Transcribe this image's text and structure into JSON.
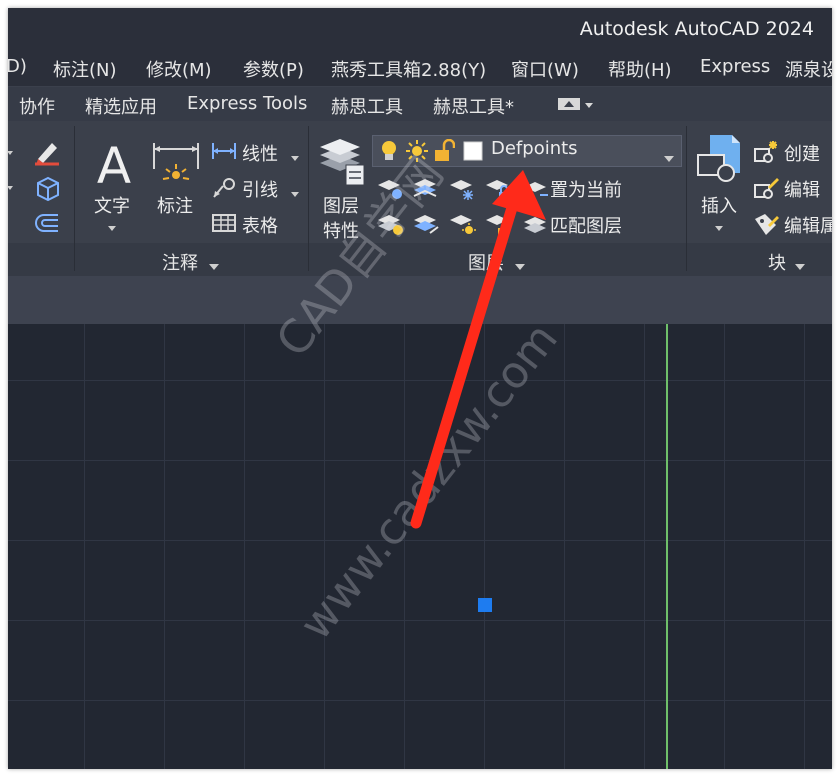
{
  "window": {
    "title": "Autodesk AutoCAD 2024"
  },
  "menubar": {
    "items": [
      "D)",
      "标注(N)",
      "修改(M)",
      "参数(P)",
      "燕秀工具箱2.88(Y)",
      "窗口(W)",
      "帮助(H)",
      "Express",
      "源泉设"
    ]
  },
  "ribbon_tabs": {
    "items": [
      "协作",
      "精选应用",
      "Express Tools",
      "赫思工具",
      "赫思工具*"
    ]
  },
  "annotation_panel": {
    "text_label": "文字",
    "dim_label": "标注",
    "linear_label": "线性",
    "leader_label": "引线",
    "table_label": "表格",
    "title": "注释"
  },
  "layer_panel": {
    "properties_label_1": "图层",
    "properties_label_2": "特性",
    "current_layer": "Defpoints",
    "set_current_label": "置为当前",
    "match_layer_label": "匹配图层",
    "title": "图层"
  },
  "block_panel": {
    "insert_label": "插入",
    "create_label": "创建",
    "edit_label": "编辑",
    "edit_attr_label": "编辑属",
    "title": "块"
  },
  "watermark": {
    "line1": "CAD自学网",
    "line2": "www.cadzxw.com"
  },
  "colors": {
    "annotation_arrow": "#ff2a1a",
    "grip": "#1e7cf0",
    "y_axis": "#6fbf6a",
    "canvas_bg": "#222732"
  }
}
